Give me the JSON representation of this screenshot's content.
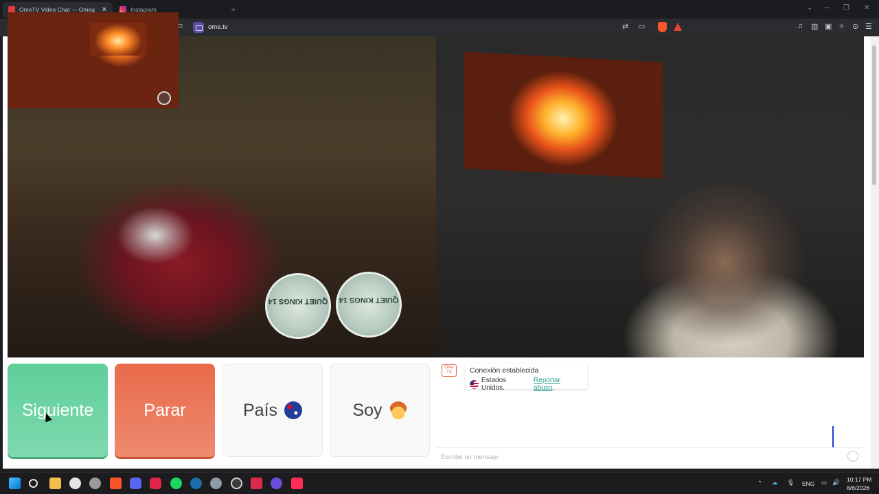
{
  "browser": {
    "tabs": [
      {
        "title": "OmeTV Video Chat — Omeg",
        "active": true
      },
      {
        "title": "Instagram",
        "active": false
      }
    ],
    "new_tab": "+",
    "url": "ome.tv"
  },
  "controls": {
    "next_label": "Siguiente",
    "stop_label": "Parar",
    "country_label": "País",
    "gender_label": "Soy"
  },
  "chat": {
    "logo_text": "Ome TV",
    "status": "Conexión establecida",
    "country": "Estados Unidos.",
    "report_link": "Reportar abuso",
    "report_suffix": ".",
    "input_placeholder": "Escribe un mensaje"
  },
  "video_left": {
    "tin_label": "QUIET KINGS 14"
  },
  "taskbar": {
    "language": "ENG",
    "time": "10:17 PM",
    "date": "8/6/2026"
  },
  "colors": {
    "next": "#5fcf9a",
    "stop": "#e96a4b",
    "link": "#2a9d8f"
  },
  "icons": [
    "windows-start-icon",
    "search-icon",
    "file-explorer-icon",
    "xbox-icon",
    "brave-icon",
    "discord-icon",
    "spotify-icon",
    "steam-icon",
    "settings-icon",
    "obs-icon",
    "tiktok-icon"
  ]
}
